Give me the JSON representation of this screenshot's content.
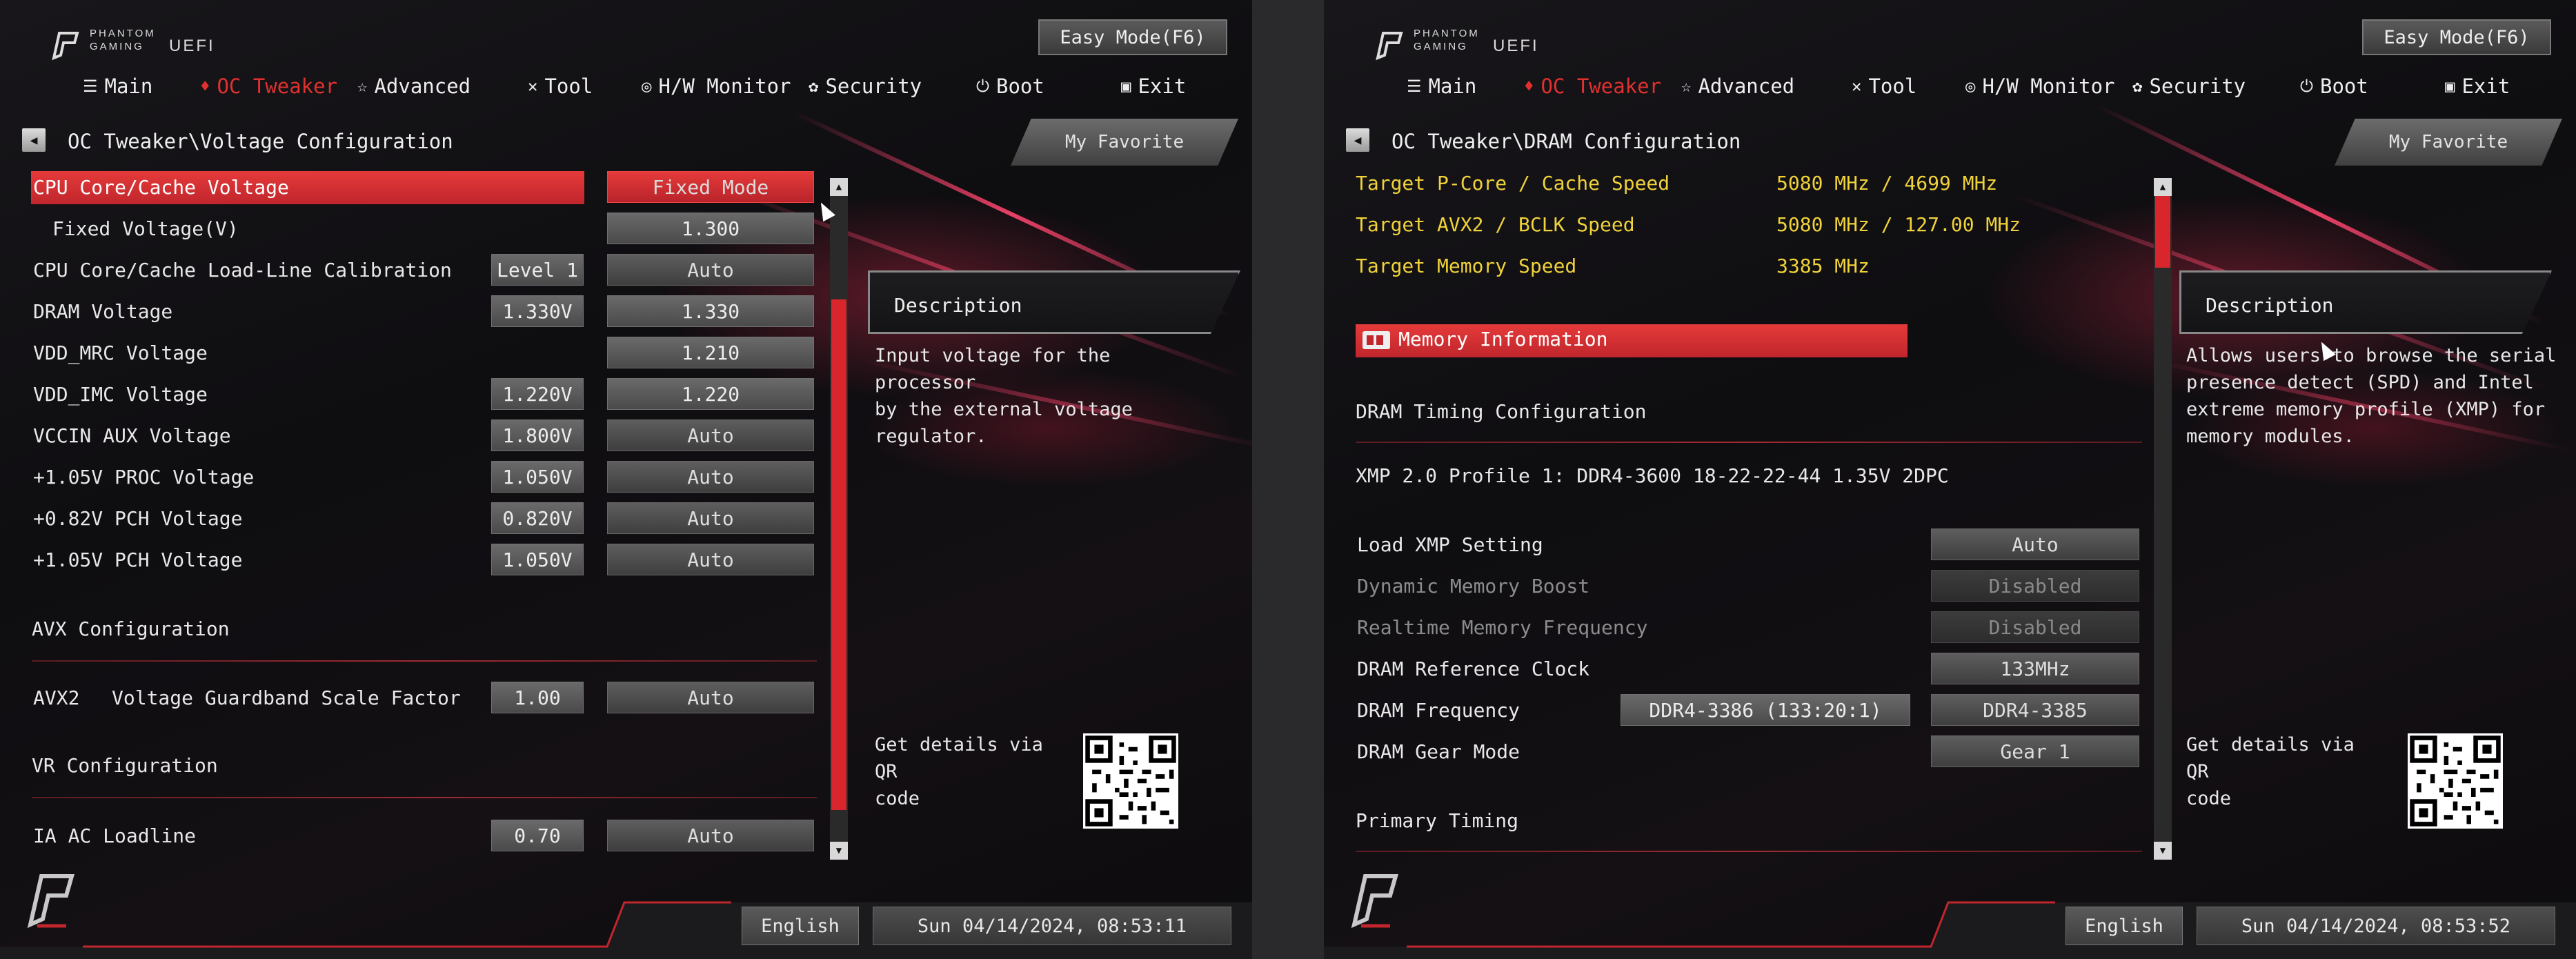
{
  "left_panel": {
    "brand": {
      "line1": "PHANTOM",
      "line2": "GAMING",
      "uefi": "UEFI"
    },
    "easy_mode": "Easy Mode(F6)",
    "nav": [
      {
        "label": "Main",
        "icon": "list-icon"
      },
      {
        "label": "OC Tweaker",
        "icon": "flame-icon",
        "active": true
      },
      {
        "label": "Advanced",
        "icon": "star-icon"
      },
      {
        "label": "Tool",
        "icon": "wrench-icon"
      },
      {
        "label": "H/W Monitor",
        "icon": "monitor-icon"
      },
      {
        "label": "Security",
        "icon": "shield-icon"
      },
      {
        "label": "Boot",
        "icon": "power-icon"
      },
      {
        "label": "Exit",
        "icon": "door-icon"
      }
    ],
    "breadcrumb": "OC Tweaker\\Voltage Configuration",
    "favorite": "My Favorite",
    "rows": [
      {
        "label": "CPU Core/Cache Voltage",
        "value": "",
        "setting": "Fixed Mode",
        "selected": true
      },
      {
        "label": "Fixed Voltage(V)",
        "value": "",
        "setting": "1.300"
      },
      {
        "label": "CPU Core/Cache Load-Line Calibration",
        "value": "Level 1",
        "setting": "Auto"
      },
      {
        "label": "DRAM Voltage",
        "value": "1.330V",
        "setting": "1.330"
      },
      {
        "label": "VDD_MRC Voltage",
        "value": "",
        "setting": "1.210"
      },
      {
        "label": "VDD_IMC Voltage",
        "value": "1.220V",
        "setting": "1.220"
      },
      {
        "label": "VCCIN AUX Voltage",
        "value": "1.800V",
        "setting": "Auto"
      },
      {
        "label": "+1.05V PROC Voltage",
        "value": "1.050V",
        "setting": "Auto"
      },
      {
        "label": "+0.82V PCH Voltage",
        "value": "0.820V",
        "setting": "Auto"
      },
      {
        "label": "+1.05V PCH Voltage",
        "value": "1.050V",
        "setting": "Auto"
      }
    ],
    "section_avx": "AVX Configuration",
    "avx_row": {
      "label": "AVX2",
      "label2": "Voltage Guardband Scale Factor",
      "value": "1.00",
      "setting": "Auto"
    },
    "section_vr": "VR Configuration",
    "vr_row": {
      "label": "IA AC Loadline",
      "value": "0.70",
      "setting": "Auto"
    },
    "description_title": "Description",
    "description": "Input voltage for the processor\nby the external voltage regulator.",
    "qr_text": "Get details via QR\ncode",
    "language": "English",
    "datetime": "Sun 04/14/2024, 08:53:11"
  },
  "right_panel": {
    "brand": {
      "line1": "PHANTOM",
      "line2": "GAMING",
      "uefi": "UEFI"
    },
    "easy_mode": "Easy Mode(F6)",
    "nav": [
      {
        "label": "Main",
        "icon": "list-icon"
      },
      {
        "label": "OC Tweaker",
        "icon": "flame-icon",
        "active": true
      },
      {
        "label": "Advanced",
        "icon": "star-icon"
      },
      {
        "label": "Tool",
        "icon": "wrench-icon"
      },
      {
        "label": "H/W Monitor",
        "icon": "monitor-icon"
      },
      {
        "label": "Security",
        "icon": "shield-icon"
      },
      {
        "label": "Boot",
        "icon": "power-icon"
      },
      {
        "label": "Exit",
        "icon": "door-icon"
      }
    ],
    "breadcrumb": "OC Tweaker\\DRAM Configuration",
    "favorite": "My Favorite",
    "targets": [
      {
        "label": "Target P-Core / Cache Speed",
        "value": "5080 MHz / 4699 MHz"
      },
      {
        "label": "Target AVX2 / BCLK Speed",
        "value": "5080 MHz / 127.00 MHz"
      },
      {
        "label": "Target Memory Speed",
        "value": "3385 MHz"
      }
    ],
    "memory_info": "Memory Information",
    "section_timing": "DRAM Timing Configuration",
    "xmp_profile": "XMP 2.0 Profile 1: DDR4-3600 18-22-22-44 1.35V 2DPC",
    "settings": [
      {
        "label": "Load XMP Setting",
        "mid": "",
        "setting": "Auto",
        "dim": false
      },
      {
        "label": "Dynamic Memory Boost",
        "mid": "",
        "setting": "Disabled",
        "dim": true
      },
      {
        "label": "Realtime Memory Frequency",
        "mid": "",
        "setting": "Disabled",
        "dim": true
      },
      {
        "label": "DRAM Reference Clock",
        "mid": "",
        "setting": "133MHz",
        "dim": false
      },
      {
        "label": "DRAM Frequency",
        "mid": "DDR4-3386 (133:20:1)",
        "setting": "DDR4-3385",
        "dim": false
      },
      {
        "label": "DRAM Gear Mode",
        "mid": "",
        "setting": "Gear 1",
        "dim": false
      }
    ],
    "section_primary": "Primary Timing",
    "description_title": "Description",
    "description": "Allows users to browse the serial\npresence detect (SPD) and Intel\nextreme memory profile (XMP) for\nmemory modules.",
    "qr_text": "Get details via QR\ncode",
    "language": "English",
    "datetime": "Sun 04/14/2024, 08:53:52"
  },
  "colors": {
    "accent": "#d9262c",
    "highlight_text": "#f0d23a",
    "background": "#0e0d10"
  }
}
